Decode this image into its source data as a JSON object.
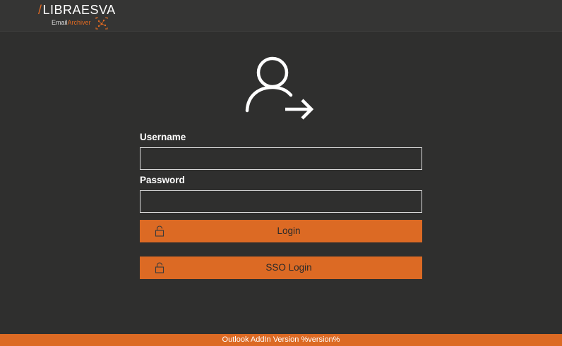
{
  "brand": {
    "name": "LIBRAESVA",
    "slash": "/",
    "sub_email": "Email",
    "sub_archiver": "Archiver",
    "accent_color": "#dc6a24"
  },
  "login_icon": "user-sign-in-icon",
  "form": {
    "username_label": "Username",
    "username_value": "",
    "password_label": "Password",
    "password_value": ""
  },
  "buttons": {
    "login_label": "Login",
    "sso_label": "SSO Login",
    "icon": "padlock-icon"
  },
  "footer": {
    "text": "Outlook AddIn Version %version%"
  }
}
